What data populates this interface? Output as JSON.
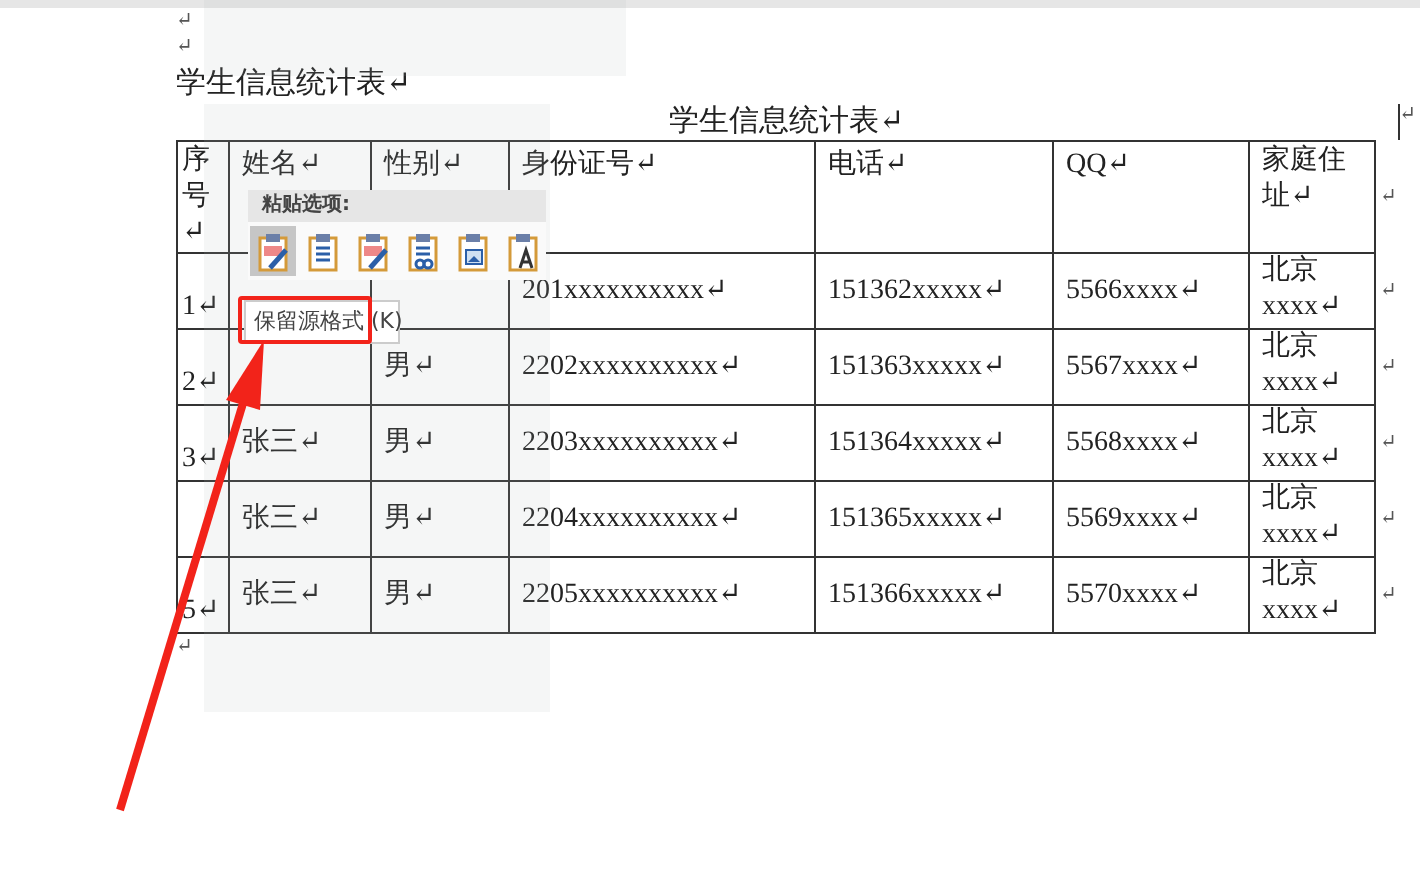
{
  "document": {
    "top_marks": [
      "↵",
      "↵"
    ],
    "heading": "学生信息统计表↵",
    "table": {
      "caption": "学生信息统计表↵",
      "caption_mark": "↵",
      "header_mark": "↵",
      "columns": [
        "序号↵",
        "姓名↵",
        "性别↵",
        "身份证号↵",
        "电话↵",
        "QQ↵",
        "家庭住址↵"
      ],
      "rows": [
        {
          "cells": [
            "1↵",
            null,
            null,
            "201xxxxxxxxxx↵",
            "151362xxxxx↵",
            "5566xxxx↵",
            "北京\nxxxx↵"
          ],
          "end_mark": "↵"
        },
        {
          "cells": [
            "2↵",
            null,
            "男↵",
            "2202xxxxxxxxxx↵",
            "151363xxxxx↵",
            "5567xxxx↵",
            "北京\nxxxx↵"
          ],
          "end_mark": "↵"
        },
        {
          "cells": [
            "3↵",
            "张三↵",
            "男↵",
            "2203xxxxxxxxxx↵",
            "151364xxxxx↵",
            "5568xxxx↵",
            "北京\nxxxx↵"
          ],
          "end_mark": "↵"
        },
        {
          "cells": [
            null,
            "张三↵",
            "男↵",
            "2204xxxxxxxxxx↵",
            "151365xxxxx↵",
            "5569xxxx↵",
            "北京\nxxxx↵"
          ],
          "end_mark": "↵"
        },
        {
          "cells": [
            "5↵",
            "张三↵",
            "男↵",
            "2205xxxxxxxxxx↵",
            "151366xxxxx↵",
            "5570xxxx↵",
            "北京\nxxxx↵"
          ],
          "end_mark": "↵"
        }
      ]
    },
    "after_mark": "↵"
  },
  "paste_options": {
    "title": "粘贴选项:",
    "buttons": [
      {
        "kind": "keep-source",
        "selected": true
      },
      {
        "kind": "merge",
        "selected": false
      },
      {
        "kind": "nested",
        "selected": false
      },
      {
        "kind": "link",
        "selected": false
      },
      {
        "kind": "picture",
        "selected": false
      },
      {
        "kind": "text",
        "selected": false
      }
    ],
    "tooltip": "保留源格式 (K)"
  }
}
